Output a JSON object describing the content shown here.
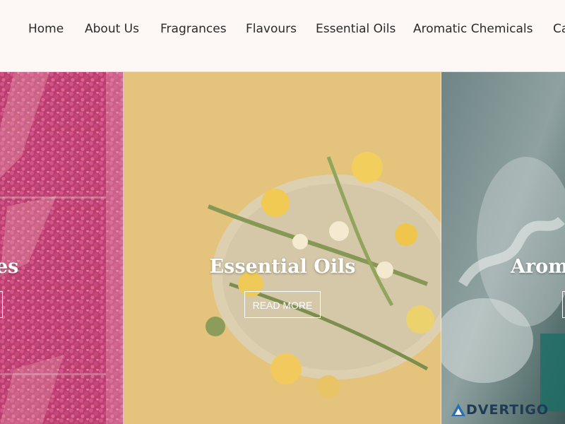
{
  "nav": {
    "items": [
      {
        "label": "Home"
      },
      {
        "label": "About Us"
      },
      {
        "label": "Fragrances"
      },
      {
        "label": "Flavours"
      },
      {
        "label": "Essential Oils"
      },
      {
        "label": "Aromatic Chemicals"
      },
      {
        "label": "Ca"
      }
    ]
  },
  "slider": {
    "panels": [
      {
        "title": "es",
        "button": ""
      },
      {
        "title": "Essential Oils",
        "button": "READ MORE"
      },
      {
        "title": "Aroma",
        "button": ""
      }
    ]
  },
  "watermark": {
    "text": "DVERTIGO",
    "accent": "#2a6fb0"
  },
  "colors": {
    "nav_bg": "#fdf8f6",
    "nav_text": "#2a2a2a",
    "button_border": "#ffffff"
  }
}
